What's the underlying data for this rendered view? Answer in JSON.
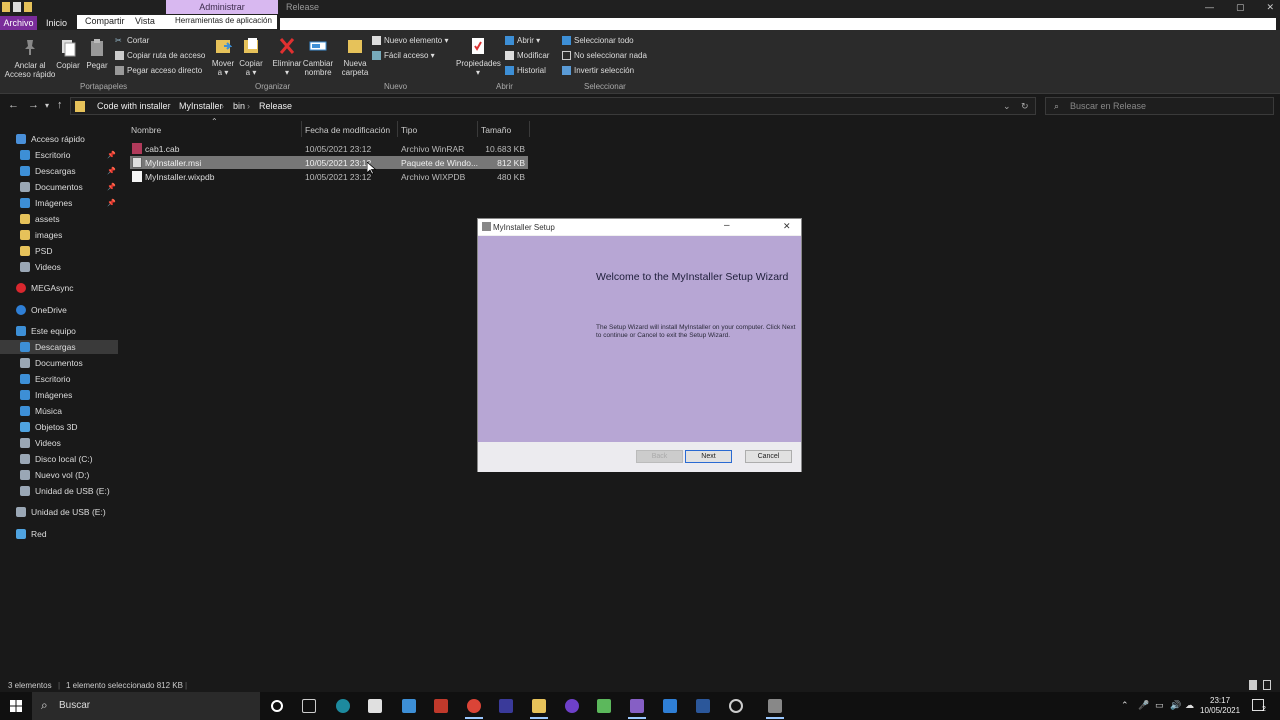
{
  "titlebar": {
    "context_tab": "Administrar",
    "context_title": "Release",
    "window_controls": [
      "—",
      "▢",
      "✕"
    ]
  },
  "ribbon_tabs": {
    "archivo": "Archivo",
    "inicio": "Inicio",
    "compartir": "Compartir",
    "vista": "Vista",
    "herramientas": "Herramientas de aplicación"
  },
  "ribbon": {
    "pin": "Anclar al\nAcceso rápido",
    "copy": "Copiar",
    "paste": "Pegar",
    "cut": "Cortar",
    "copy_path": "Copiar ruta de acceso",
    "paste_shortcut": "Pegar acceso directo",
    "move_to": "Mover\na ▾",
    "copy_to": "Copiar\na ▾",
    "delete": "Eliminar\n▾",
    "rename": "Cambiar\nnombre",
    "new_folder": "Nueva\ncarpeta",
    "new_item": "Nuevo elemento ▾",
    "easy_access": "Fácil acceso ▾",
    "properties": "Propiedades\n▾",
    "open": "Abrir ▾",
    "edit": "Modificar",
    "history": "Historial",
    "select_all": "Seleccionar todo",
    "select_none": "No seleccionar nada",
    "invert": "Invertir selección",
    "groups": {
      "clipboard": "Portapapeles",
      "organize": "Organizar",
      "new": "Nuevo",
      "open": "Abrir",
      "select": "Seleccionar"
    }
  },
  "address": {
    "crumbs": [
      "Code with installer",
      "MyInstaller",
      "bin",
      "Release"
    ],
    "search_placeholder": "Buscar en Release"
  },
  "sidebar": {
    "items": [
      {
        "label": "Acceso rápido",
        "color": "#4a90d9"
      },
      {
        "label": "Escritorio",
        "color": "#3d8fd6"
      },
      {
        "label": "Descargas",
        "color": "#3d8fd6"
      },
      {
        "label": "Documentos",
        "color": "#9aa7b5"
      },
      {
        "label": "Imágenes",
        "color": "#3d8fd6"
      },
      {
        "label": "assets",
        "color": "#e6c25a"
      },
      {
        "label": "images",
        "color": "#e6c25a"
      },
      {
        "label": "PSD",
        "color": "#e6c25a"
      },
      {
        "label": "Videos",
        "color": "#9aa7b5"
      },
      {
        "label": "MEGAsync",
        "color": "#d9272e"
      },
      {
        "label": "OneDrive",
        "color": "#2f7fd6"
      },
      {
        "label": "Este equipo",
        "color": "#3d8fd6"
      },
      {
        "label": "Descargas",
        "color": "#3d8fd6"
      },
      {
        "label": "Documentos",
        "color": "#9aa7b5"
      },
      {
        "label": "Escritorio",
        "color": "#3d8fd6"
      },
      {
        "label": "Imágenes",
        "color": "#3d8fd6"
      },
      {
        "label": "Música",
        "color": "#3d8fd6"
      },
      {
        "label": "Objetos 3D",
        "color": "#4fa3e0"
      },
      {
        "label": "Videos",
        "color": "#9aa7b5"
      },
      {
        "label": "Disco local (C:)",
        "color": "#9aa7b5"
      },
      {
        "label": "Nuevo vol (D:)",
        "color": "#9aa7b5"
      },
      {
        "label": "Unidad de USB (E:)",
        "color": "#9aa7b5"
      },
      {
        "label": "Unidad de USB (E:)",
        "color": "#9aa7b5"
      },
      {
        "label": "Red",
        "color": "#4fa3e0"
      }
    ]
  },
  "files": {
    "headers": [
      "Nombre",
      "Fecha de modificación",
      "Tipo",
      "Tamaño"
    ],
    "rows": [
      {
        "name": "cab1.cab",
        "date": "10/05/2021 23:12",
        "type": "Archivo WinRAR",
        "size": "10.683 KB"
      },
      {
        "name": "MyInstaller.msi",
        "date": "10/05/2021 23:12",
        "type": "Paquete de Windo...",
        "size": "812 KB"
      },
      {
        "name": "MyInstaller.wixpdb",
        "date": "10/05/2021 23:12",
        "type": "Archivo WIXPDB",
        "size": "480 KB"
      }
    ]
  },
  "dialog": {
    "title": "MyInstaller Setup",
    "heading": "Welcome to the MyInstaller Setup Wizard",
    "message": "The Setup Wizard will install MyInstaller on your computer. Click Next to continue or Cancel to exit the Setup Wizard.",
    "back": "Back",
    "next": "Next",
    "cancel": "Cancel"
  },
  "status": {
    "count": "3 elementos",
    "selected": "1 elemento seleccionado 812 KB"
  },
  "taskbar": {
    "search": "Buscar",
    "time": "23:17",
    "date": "10/05/2021",
    "notif_count": "2"
  }
}
